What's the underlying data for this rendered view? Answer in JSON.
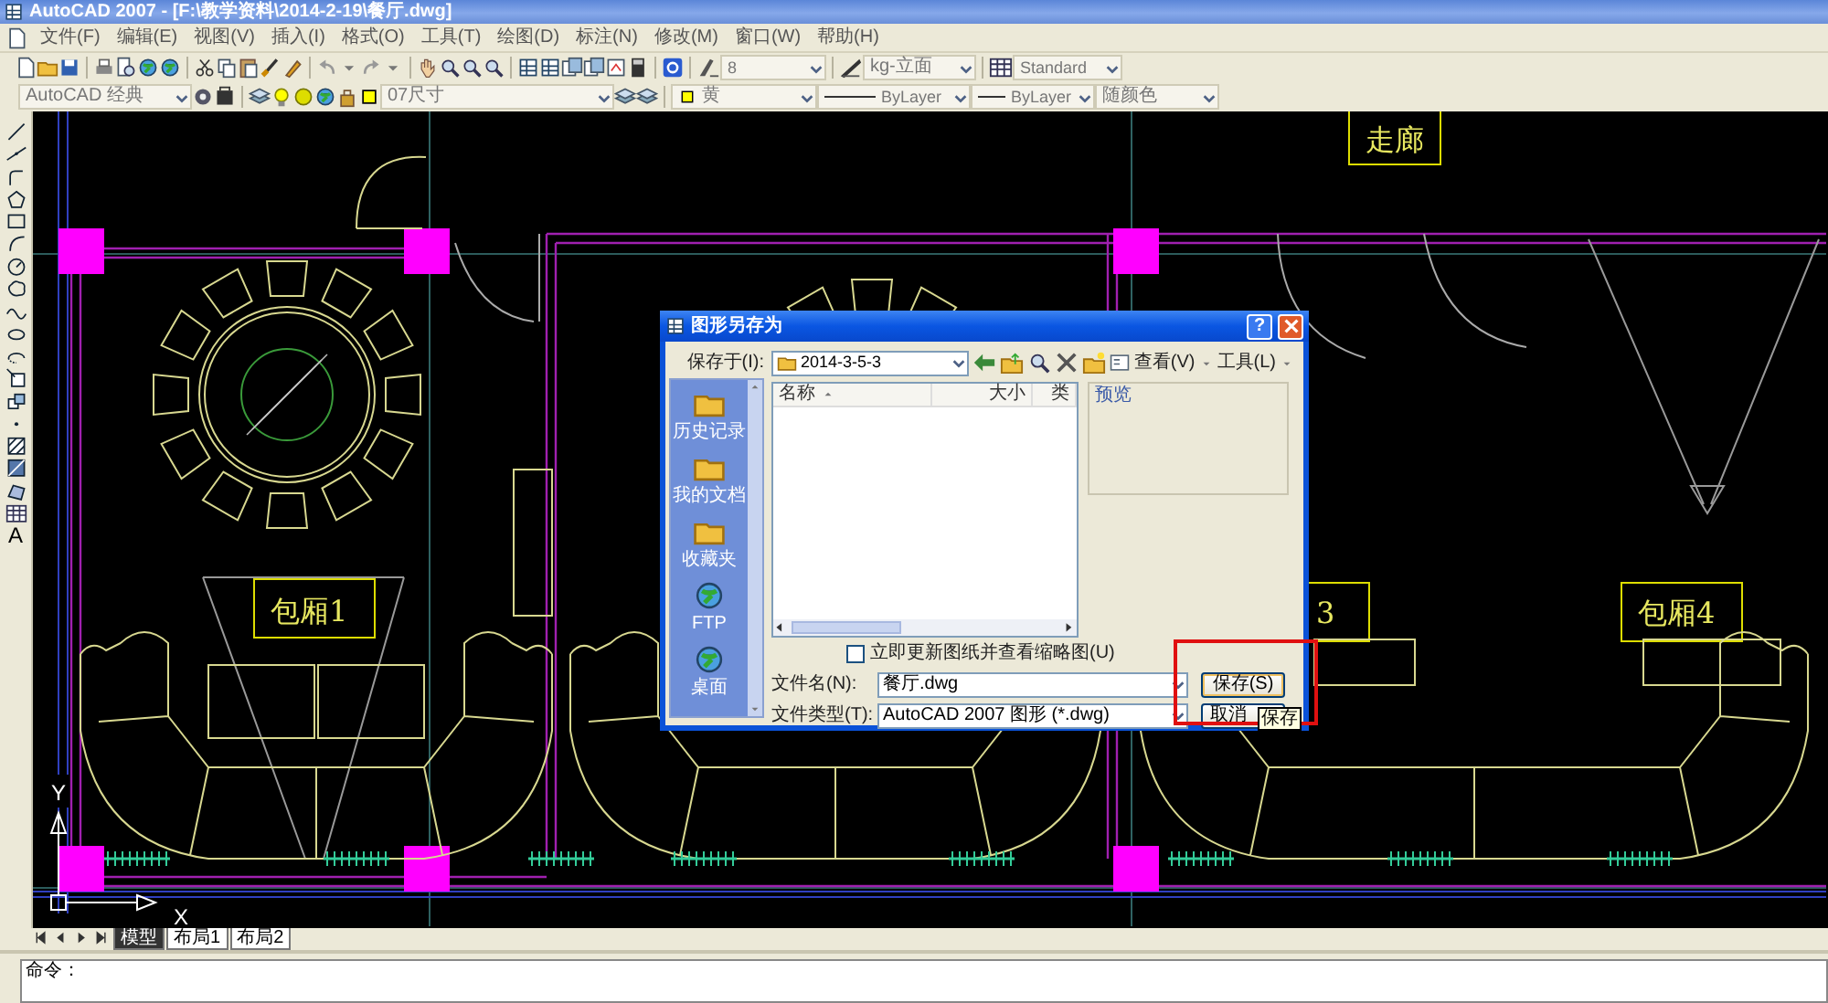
{
  "window": {
    "title": "AutoCAD 2007 - [F:\\教学资料\\2014-2-19\\餐厅.dwg]"
  },
  "menu": [
    "文件(F)",
    "编辑(E)",
    "视图(V)",
    "插入(I)",
    "格式(O)",
    "工具(T)",
    "绘图(D)",
    "标注(N)",
    "修改(M)",
    "窗口(W)",
    "帮助(H)"
  ],
  "toolbars": {
    "text_style": "8",
    "dim_style": "kg-立面",
    "table_style": "Standard",
    "workspace": "AutoCAD 经典",
    "layer": "07尺寸",
    "color_control": "黄",
    "linetype": "ByLayer",
    "lineweight": "ByLayer",
    "plot_style": "随颜色"
  },
  "draw_toolbar": {
    "text_tool": "A"
  },
  "drawing": {
    "room_labels": [
      "包厢1",
      "3",
      "包厢4",
      "走廊"
    ],
    "ucs": {
      "x_label": "X",
      "y_label": "Y"
    }
  },
  "dialog": {
    "title": "图形另存为",
    "help_button": "?",
    "save_in_label": "保存于(I):",
    "folder": "2014-3-5-3",
    "views_menu": "查看(V)",
    "tools_menu": "工具(L)",
    "places": [
      {
        "label": "历史记录"
      },
      {
        "label": "我的文档"
      },
      {
        "label": "收藏夹"
      },
      {
        "label": "FTP"
      },
      {
        "label": "桌面"
      }
    ],
    "columns": [
      {
        "label": "名称",
        "sorted": true
      },
      {
        "label": "大小",
        "sorted": false
      },
      {
        "label": "类",
        "sorted": false
      }
    ],
    "preview_label": "预览",
    "update_thumbnail": {
      "label": "立即更新图纸并查看缩略图(U)",
      "checked": false
    },
    "file_name_label": "文件名(N):",
    "file_name": "餐厅.dwg",
    "file_type_label": "文件类型(T):",
    "file_type": "AutoCAD 2007 图形 (*.dwg)",
    "buttons": [
      {
        "label": "保存(S)",
        "highlighted": true
      },
      {
        "label": "取消",
        "highlighted": false
      }
    ],
    "tooltip": "保存"
  },
  "layout_tabs": [
    {
      "label": "模型",
      "selected": true
    },
    {
      "label": "布局1",
      "selected": false
    },
    {
      "label": "布局2",
      "selected": false
    }
  ],
  "command_line": {
    "prompt": "命令："
  }
}
